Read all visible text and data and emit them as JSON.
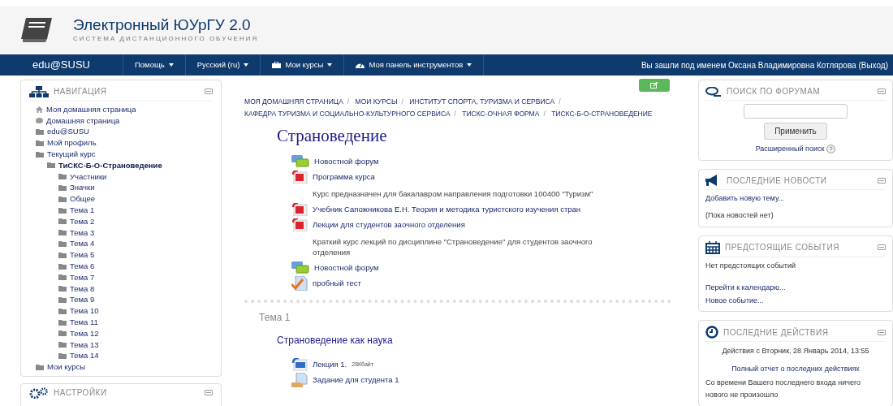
{
  "header": {
    "title": "Электронный ЮУрГУ 2.0",
    "subtitle": "СИСТЕМА ДИСТАНЦИОННОГО ОБУЧЕНИЯ"
  },
  "navbar": {
    "brand": "edu@SUSU",
    "menus": [
      {
        "label": "Помощь",
        "kind": "plain"
      },
      {
        "label": "Русский (ru)",
        "kind": "plain"
      },
      {
        "label": "Мои курсы",
        "kind": "briefcase"
      },
      {
        "label": "Моя панель инструментов",
        "kind": "gauge"
      }
    ],
    "user_text": "Вы зашли под именем Оксана Владимировна Котлярова (Выход)"
  },
  "navigation": {
    "title": "НАВИГАЦИЯ",
    "items": [
      {
        "label": "Моя домашняя страница",
        "kind": "home",
        "current": false
      },
      {
        "label": "Домашняя страница",
        "kind": "dot",
        "current": false
      },
      {
        "label": "edu@SUSU",
        "kind": "folder",
        "current": false
      },
      {
        "label": "Мой профиль",
        "kind": "folder",
        "current": false
      },
      {
        "label": "Текущий курс",
        "kind": "folder",
        "current": false,
        "children": [
          {
            "label": "ТиСКС-Б-О-Страноведение",
            "kind": "folder",
            "current": true,
            "children": [
              {
                "label": "Участники",
                "kind": "folder",
                "current": false
              },
              {
                "label": "Значки",
                "kind": "folder",
                "current": false
              },
              {
                "label": "Общее",
                "kind": "folder",
                "current": false
              },
              {
                "label": "Тема 1",
                "kind": "folder",
                "current": false
              },
              {
                "label": "Тема 2",
                "kind": "folder",
                "current": false
              },
              {
                "label": "Тема 3",
                "kind": "folder",
                "current": false
              },
              {
                "label": "Тема 4",
                "kind": "folder",
                "current": false
              },
              {
                "label": "Тема 5",
                "kind": "folder",
                "current": false
              },
              {
                "label": "Тема 6",
                "kind": "folder",
                "current": false
              },
              {
                "label": "Тема 7",
                "kind": "folder",
                "current": false
              },
              {
                "label": "Тема 8",
                "kind": "folder",
                "current": false
              },
              {
                "label": "Тема 9",
                "kind": "folder",
                "current": false
              },
              {
                "label": "Тема 10",
                "kind": "folder",
                "current": false
              },
              {
                "label": "Тема 11",
                "kind": "folder",
                "current": false
              },
              {
                "label": "Тема 12",
                "kind": "folder",
                "current": false
              },
              {
                "label": "Тема 13",
                "kind": "folder",
                "current": false
              },
              {
                "label": "Тема 14",
                "kind": "folder",
                "current": false
              }
            ]
          }
        ]
      },
      {
        "label": "Мои курсы",
        "kind": "folder",
        "current": false
      }
    ]
  },
  "settings": {
    "title": "НАСТРОЙКИ"
  },
  "breadcrumb_separator": "/",
  "breadcrumb": [
    "МОЯ ДОМАШНЯЯ СТРАНИЦА",
    "МОИ КУРСЫ",
    "ИНСТИТУТ СПОРТА, ТУРИЗМА И СЕРВИСА",
    "КАФЕДРА ТУРИЗМА И СОЦИАЛЬНО-КУЛЬТУРНОГО СЕРВИСА",
    "ТИСКС-ОЧНАЯ ФОРМА",
    "ТИСКС-Б-О-СТРАНОВЕДЕНИЕ"
  ],
  "course_title": "Страноведение",
  "activities": [
    {
      "kind": "forum",
      "label": "Новостной форум"
    },
    {
      "kind": "pdf",
      "label": "Программа курса",
      "description": "Курс предназначен для бакалавром направления подготовки 100400 \"Туризм\""
    },
    {
      "kind": "pdf",
      "label": "Учебник Сапожникова Е.Н. Теория и методика туристского изучения стран"
    },
    {
      "kind": "pdf",
      "label": "Лекции для студентов заочного отделения",
      "description": "Краткий курс лекций по дисциплине \"Страноведение\" для студентов заочного отделения"
    },
    {
      "kind": "forum",
      "label": "Новостной форум"
    },
    {
      "kind": "quiz",
      "label": "пробный тест"
    }
  ],
  "section": {
    "heading": "Тема 1",
    "title": "Страноведение как наука",
    "activities": [
      {
        "kind": "word",
        "label": "Лекция 1.",
        "size": "28Кбайт"
      },
      {
        "kind": "assign",
        "label": "Задание для студента 1"
      }
    ]
  },
  "forum_search": {
    "title": "ПОИСК ПО ФОРУМАМ",
    "button": "Применить",
    "advanced": "Расширенный поиск"
  },
  "news": {
    "title": "ПОСЛЕДНИЕ НОВОСТИ",
    "link": "Добавить новую тему...",
    "empty": "(Пока новостей нет)"
  },
  "events": {
    "title": "ПРЕДСТОЯЩИЕ СОБЫТИЯ",
    "empty": "Нет предстоящих событий",
    "links": [
      "Перейти к календарю...",
      "Новое событие..."
    ]
  },
  "activity": {
    "title": "ПОСЛЕДНИЕ ДЕЙСТВИЯ",
    "since": "Действия с Вторник, 28 Январь 2014, 13:55",
    "report": "Полный отчет о последних действиях",
    "note": "Со времени Вашего последнего входа ничего нового не произошло"
  }
}
